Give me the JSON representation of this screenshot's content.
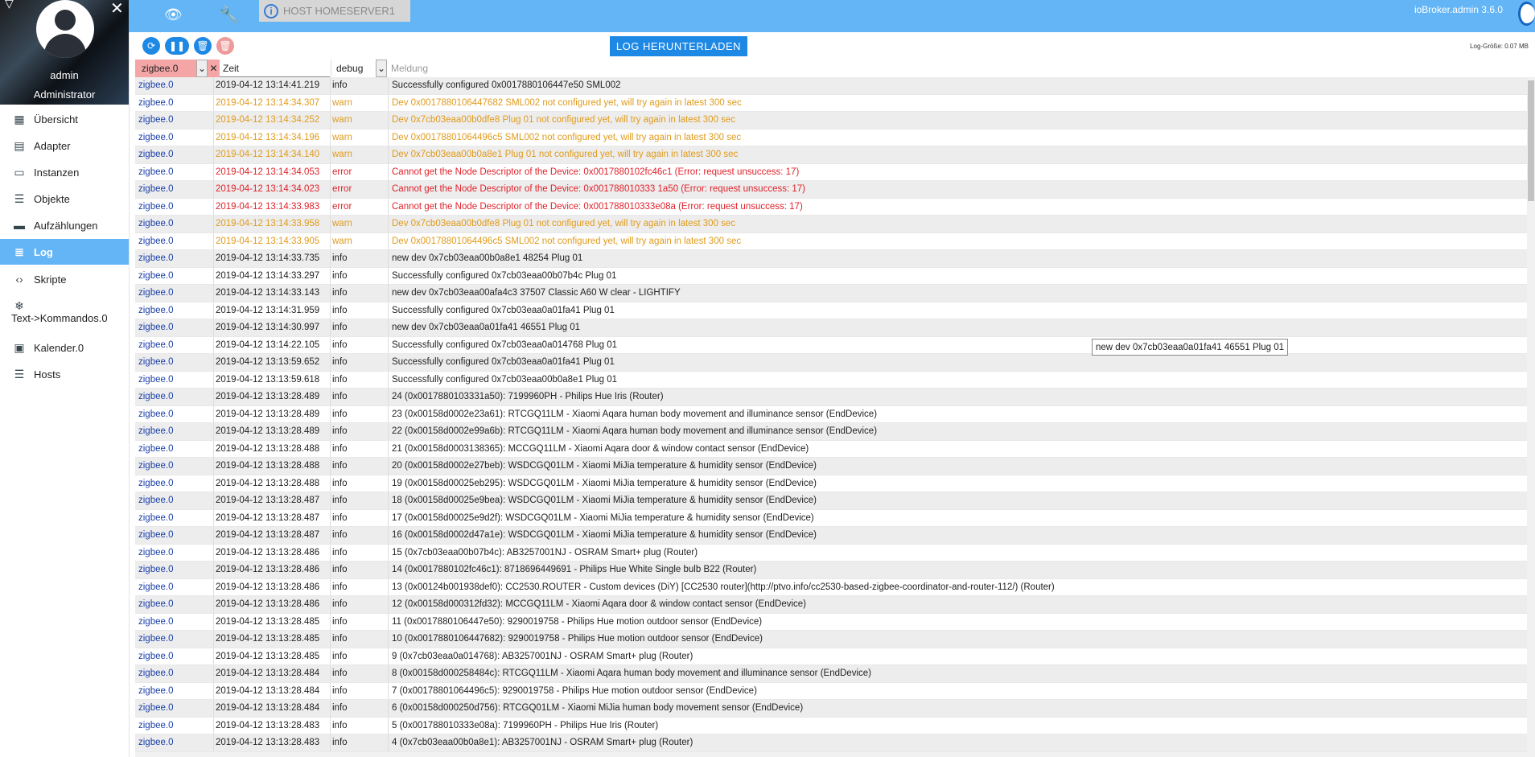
{
  "sidebar": {
    "user_name": "admin",
    "user_role": "Administrator",
    "items": [
      {
        "label": "Übersicht",
        "icon": "apps-grid-icon"
      },
      {
        "label": "Adapter",
        "icon": "store-icon"
      },
      {
        "label": "Instanzen",
        "icon": "instances-icon"
      },
      {
        "label": "Objekte",
        "icon": "list-icon"
      },
      {
        "label": "Aufzählungen",
        "icon": "enum-icon"
      },
      {
        "label": "Log",
        "icon": "log-lines-icon",
        "active": true
      },
      {
        "label": "Skripte",
        "icon": "code-icon"
      },
      {
        "label": "Text->Kommandos.0",
        "icon": "snowflake-icon"
      },
      {
        "label": "Kalender.0",
        "icon": "calendar-contact-icon"
      },
      {
        "label": "Hosts",
        "icon": "hosts-list-icon"
      }
    ]
  },
  "topbar": {
    "host_label": "HOST HOMESERVER1",
    "version": "ioBroker.admin 3.6.0"
  },
  "toolbar": {
    "download_label": "LOG HERUNTERLADEN",
    "log_size": "Log-Größe: 0.07 MB"
  },
  "filters": {
    "source_value": "zigbee.0",
    "time_placeholder": "Zeit",
    "severity_value": "debug",
    "message_placeholder": "Meldung"
  },
  "tooltip": "new dev 0x7cb03eaa0a01fa41 46551 Plug 01",
  "colors": {
    "accent": "#64b5f6",
    "warn": "#e09b1b",
    "error": "#e0222a",
    "source": "#1a3fa8"
  },
  "log_rows": [
    {
      "src": "zigbee.0",
      "time": "2019-04-12 13:14:41.219",
      "sev": "info",
      "msg": "Successfully configured 0x0017880106447e50 SML002"
    },
    {
      "src": "zigbee.0",
      "time": "2019-04-12 13:14:34.307",
      "sev": "warn",
      "msg": "Dev 0x0017880106447682 SML002 not configured yet, will try again in latest 300 sec"
    },
    {
      "src": "zigbee.0",
      "time": "2019-04-12 13:14:34.252",
      "sev": "warn",
      "msg": "Dev 0x7cb03eaa00b0dfe8 Plug 01 not configured yet, will try again in latest 300 sec"
    },
    {
      "src": "zigbee.0",
      "time": "2019-04-12 13:14:34.196",
      "sev": "warn",
      "msg": "Dev 0x00178801064496c5 SML002 not configured yet, will try again in latest 300 sec"
    },
    {
      "src": "zigbee.0",
      "time": "2019-04-12 13:14:34.140",
      "sev": "warn",
      "msg": "Dev 0x7cb03eaa00b0a8e1 Plug 01 not configured yet, will try again in latest 300 sec"
    },
    {
      "src": "zigbee.0",
      "time": "2019-04-12 13:14:34.053",
      "sev": "error",
      "msg": "Cannot get the Node Descriptor of the Device: 0x0017880102fc46c1 (Error: request unsuccess: 17)"
    },
    {
      "src": "zigbee.0",
      "time": "2019-04-12 13:14:34.023",
      "sev": "error",
      "msg": "Cannot get the Node Descriptor of the Device: 0x001788010333 1a50 (Error: request unsuccess: 17)"
    },
    {
      "src": "zigbee.0",
      "time": "2019-04-12 13:14:33.983",
      "sev": "error",
      "msg": "Cannot get the Node Descriptor of the Device: 0x001788010333e08a (Error: request unsuccess: 17)"
    },
    {
      "src": "zigbee.0",
      "time": "2019-04-12 13:14:33.958",
      "sev": "warn",
      "msg": "Dev 0x7cb03eaa00b0dfe8 Plug 01 not configured yet, will try again in latest 300 sec"
    },
    {
      "src": "zigbee.0",
      "time": "2019-04-12 13:14:33.905",
      "sev": "warn",
      "msg": "Dev 0x00178801064496c5 SML002 not configured yet, will try again in latest 300 sec"
    },
    {
      "src": "zigbee.0",
      "time": "2019-04-12 13:14:33.735",
      "sev": "info",
      "msg": "new dev 0x7cb03eaa00b0a8e1 48254 Plug 01"
    },
    {
      "src": "zigbee.0",
      "time": "2019-04-12 13:14:33.297",
      "sev": "info",
      "msg": "Successfully configured 0x7cb03eaa00b07b4c Plug 01"
    },
    {
      "src": "zigbee.0",
      "time": "2019-04-12 13:14:33.143",
      "sev": "info",
      "msg": "new dev 0x7cb03eaa00afa4c3 37507 Classic A60 W clear - LIGHTIFY"
    },
    {
      "src": "zigbee.0",
      "time": "2019-04-12 13:14:31.959",
      "sev": "info",
      "msg": "Successfully configured 0x7cb03eaa0a01fa41 Plug 01"
    },
    {
      "src": "zigbee.0",
      "time": "2019-04-12 13:14:30.997",
      "sev": "info",
      "msg": "new dev 0x7cb03eaa0a01fa41 46551 Plug 01"
    },
    {
      "src": "zigbee.0",
      "time": "2019-04-12 13:14:22.105",
      "sev": "info",
      "msg": "Successfully configured 0x7cb03eaa0a014768 Plug 01"
    },
    {
      "src": "zigbee.0",
      "time": "2019-04-12 13:13:59.652",
      "sev": "info",
      "msg": "Successfully configured 0x7cb03eaa0a01fa41 Plug 01"
    },
    {
      "src": "zigbee.0",
      "time": "2019-04-12 13:13:59.618",
      "sev": "info",
      "msg": "Successfully configured 0x7cb03eaa00b0a8e1 Plug 01"
    },
    {
      "src": "zigbee.0",
      "time": "2019-04-12 13:13:28.489",
      "sev": "info",
      "msg": "24 (0x0017880103331a50): 7199960PH - Philips Hue Iris (Router)"
    },
    {
      "src": "zigbee.0",
      "time": "2019-04-12 13:13:28.489",
      "sev": "info",
      "msg": "23 (0x00158d0002e23a61): RTCGQ11LM - Xiaomi Aqara human body movement and illuminance sensor (EndDevice)"
    },
    {
      "src": "zigbee.0",
      "time": "2019-04-12 13:13:28.489",
      "sev": "info",
      "msg": "22 (0x00158d0002e99a6b): RTCGQ11LM - Xiaomi Aqara human body movement and illuminance sensor (EndDevice)"
    },
    {
      "src": "zigbee.0",
      "time": "2019-04-12 13:13:28.488",
      "sev": "info",
      "msg": "21 (0x00158d0003138365): MCCGQ11LM - Xiaomi Aqara door & window contact sensor (EndDevice)"
    },
    {
      "src": "zigbee.0",
      "time": "2019-04-12 13:13:28.488",
      "sev": "info",
      "msg": "20 (0x00158d0002e27beb): WSDCGQ01LM - Xiaomi MiJia temperature & humidity sensor (EndDevice)"
    },
    {
      "src": "zigbee.0",
      "time": "2019-04-12 13:13:28.488",
      "sev": "info",
      "msg": "19 (0x00158d00025eb295): WSDCGQ01LM - Xiaomi MiJia temperature & humidity sensor (EndDevice)"
    },
    {
      "src": "zigbee.0",
      "time": "2019-04-12 13:13:28.487",
      "sev": "info",
      "msg": "18 (0x00158d00025e9bea): WSDCGQ01LM - Xiaomi MiJia temperature & humidity sensor (EndDevice)"
    },
    {
      "src": "zigbee.0",
      "time": "2019-04-12 13:13:28.487",
      "sev": "info",
      "msg": "17 (0x00158d00025e9d2f): WSDCGQ01LM - Xiaomi MiJia temperature & humidity sensor (EndDevice)"
    },
    {
      "src": "zigbee.0",
      "time": "2019-04-12 13:13:28.487",
      "sev": "info",
      "msg": "16 (0x00158d0002d47a1e): WSDCGQ01LM - Xiaomi MiJia temperature & humidity sensor (EndDevice)"
    },
    {
      "src": "zigbee.0",
      "time": "2019-04-12 13:13:28.486",
      "sev": "info",
      "msg": "15 (0x7cb03eaa00b07b4c): AB3257001NJ - OSRAM Smart+ plug (Router)"
    },
    {
      "src": "zigbee.0",
      "time": "2019-04-12 13:13:28.486",
      "sev": "info",
      "msg": "14 (0x0017880102fc46c1): 8718696449691 - Philips Hue White Single bulb B22 (Router)"
    },
    {
      "src": "zigbee.0",
      "time": "2019-04-12 13:13:28.486",
      "sev": "info",
      "msg": "13 (0x00124b001938def0): CC2530.ROUTER - Custom devices (DiY) [CC2530 router](http://ptvo.info/cc2530-based-zigbee-coordinator-and-router-112/) (Router)"
    },
    {
      "src": "zigbee.0",
      "time": "2019-04-12 13:13:28.486",
      "sev": "info",
      "msg": "12 (0x00158d000312fd32): MCCGQ11LM - Xiaomi Aqara door & window contact sensor (EndDevice)"
    },
    {
      "src": "zigbee.0",
      "time": "2019-04-12 13:13:28.485",
      "sev": "info",
      "msg": "11 (0x0017880106447e50): 9290019758 - Philips Hue motion outdoor sensor (EndDevice)"
    },
    {
      "src": "zigbee.0",
      "time": "2019-04-12 13:13:28.485",
      "sev": "info",
      "msg": "10 (0x0017880106447682): 9290019758 - Philips Hue motion outdoor sensor (EndDevice)"
    },
    {
      "src": "zigbee.0",
      "time": "2019-04-12 13:13:28.485",
      "sev": "info",
      "msg": "9 (0x7cb03eaa0a014768): AB3257001NJ - OSRAM Smart+ plug (Router)"
    },
    {
      "src": "zigbee.0",
      "time": "2019-04-12 13:13:28.484",
      "sev": "info",
      "msg": "8 (0x00158d000258484c): RTCGQ11LM - Xiaomi Aqara human body movement and illuminance sensor (EndDevice)"
    },
    {
      "src": "zigbee.0",
      "time": "2019-04-12 13:13:28.484",
      "sev": "info",
      "msg": "7 (0x00178801064496c5): 9290019758 - Philips Hue motion outdoor sensor (EndDevice)"
    },
    {
      "src": "zigbee.0",
      "time": "2019-04-12 13:13:28.484",
      "sev": "info",
      "msg": "6 (0x00158d000250d756): RTCGQ01LM - Xiaomi MiJia human body movement sensor (EndDevice)"
    },
    {
      "src": "zigbee.0",
      "time": "2019-04-12 13:13:28.483",
      "sev": "info",
      "msg": "5 (0x001788010333e08a): 7199960PH - Philips Hue Iris (Router)"
    },
    {
      "src": "zigbee.0",
      "time": "2019-04-12 13:13:28.483",
      "sev": "info",
      "msg": "4 (0x7cb03eaa00b0a8e1): AB3257001NJ - OSRAM Smart+ plug (Router)"
    }
  ]
}
